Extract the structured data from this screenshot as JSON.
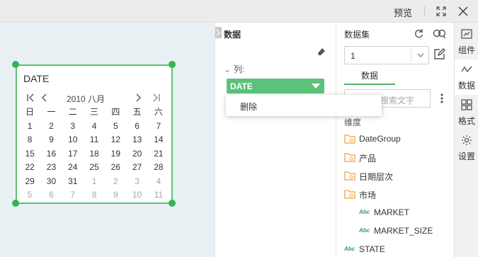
{
  "topbar": {
    "preview": "预览"
  },
  "widget": {
    "title": "DATE",
    "month_label": "2010 八月",
    "weekdays": [
      "日",
      "一",
      "二",
      "三",
      "四",
      "五",
      "六"
    ],
    "weeks": [
      [
        "1",
        "2",
        "3",
        "4",
        "5",
        "6",
        "7"
      ],
      [
        "8",
        "9",
        "10",
        "11",
        "12",
        "13",
        "14"
      ],
      [
        "15",
        "16",
        "17",
        "18",
        "19",
        "20",
        "21"
      ],
      [
        "22",
        "23",
        "24",
        "25",
        "26",
        "27",
        "28"
      ],
      [
        "29",
        "30",
        "31",
        "1",
        "2",
        "3",
        "4"
      ],
      [
        "5",
        "6",
        "7",
        "8",
        "9",
        "10",
        "11"
      ]
    ]
  },
  "data_panel": {
    "title": "数据",
    "column_label": "列:",
    "field_pill": "DATE",
    "menu_delete": "删除"
  },
  "dataset_panel": {
    "title": "数据集",
    "selected": "1",
    "subtab": "数据",
    "search_placeholder": "搜索文字",
    "dimension_label": "维度",
    "tree": [
      {
        "label": "DateGroup",
        "kind": "folder"
      },
      {
        "label": "产品",
        "kind": "folder"
      },
      {
        "label": "日期层次",
        "kind": "folder"
      },
      {
        "label": "市场",
        "kind": "folder"
      },
      {
        "label": "MARKET",
        "kind": "field"
      },
      {
        "label": "MARKET_SIZE",
        "kind": "field"
      },
      {
        "label": "STATE",
        "kind": "field"
      }
    ]
  },
  "rail": [
    {
      "label": "组件",
      "icon": "component-icon",
      "active": false
    },
    {
      "label": "数据",
      "icon": "data-icon",
      "active": true
    },
    {
      "label": "格式",
      "icon": "format-icon",
      "active": false
    },
    {
      "label": "设置",
      "icon": "settings-icon",
      "active": false
    }
  ],
  "colors": {
    "accent": "#5cc27a",
    "handle": "#31b452",
    "folder": "#f0a53c"
  }
}
